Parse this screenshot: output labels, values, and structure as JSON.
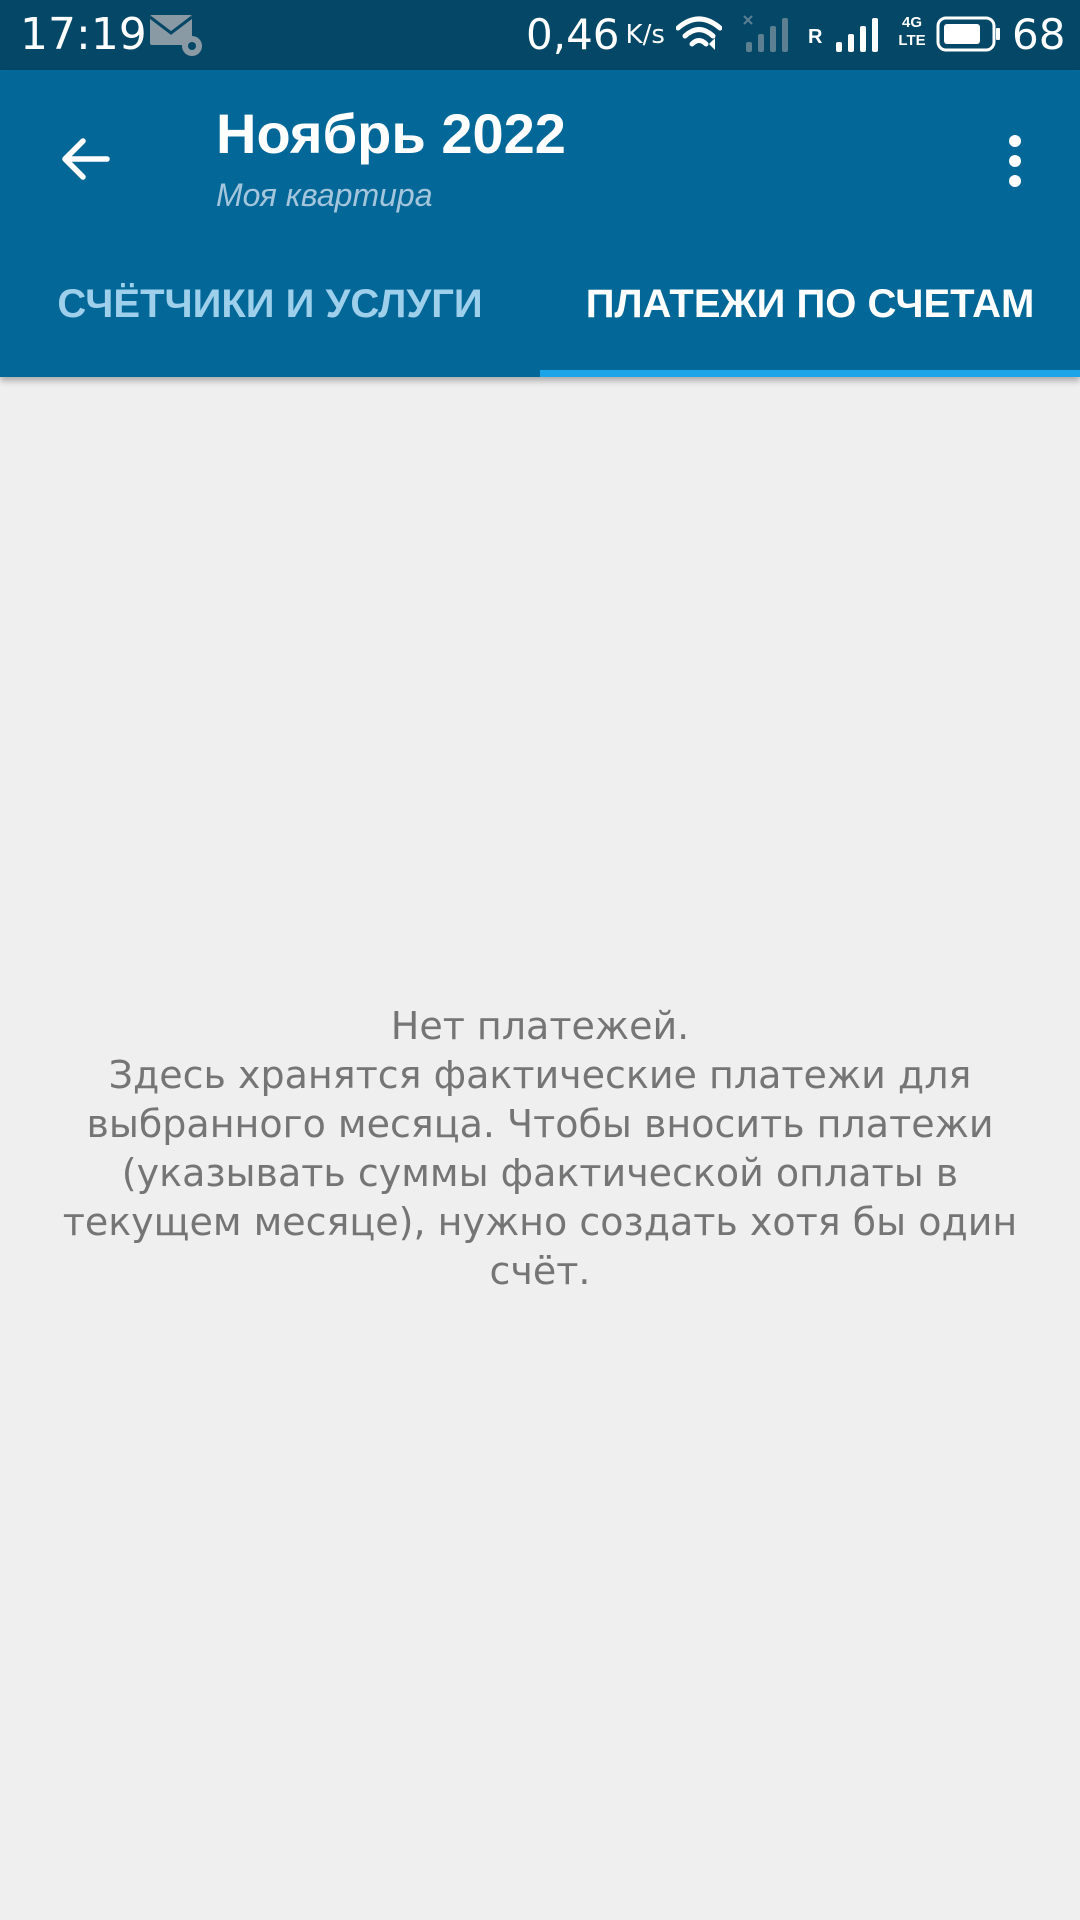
{
  "status_bar": {
    "time": "17:19",
    "net_speed": "0,46",
    "net_speed_unit": "K/s",
    "roaming": "R",
    "network_type": "4G LTE",
    "battery": "68",
    "icons": [
      "mail-settings-icon",
      "wifi-icon",
      "signal-icon",
      "battery-icon"
    ]
  },
  "app_bar": {
    "title": "Ноябрь 2022",
    "subtitle": "Моя квартира",
    "back_icon": "arrow-back-icon",
    "menu_icon": "more-vert-icon",
    "background": "#036797"
  },
  "tabs": [
    {
      "label": "СЧЁТЧИКИ И УСЛУГИ",
      "active": false
    },
    {
      "label": "ПЛАТЕЖИ ПО СЧЕТАМ",
      "active": true
    }
  ],
  "accent_color": "#1ba4e8",
  "empty_state": {
    "title": "Нет платежей.",
    "lines": [
      "Здесь хранятся фактические платежи для",
      "выбранного месяца. Чтобы вносить платежи",
      "(указывать суммы фактической оплаты в",
      "текущем месяце), нужно создать хотя бы один",
      "счёт."
    ]
  }
}
